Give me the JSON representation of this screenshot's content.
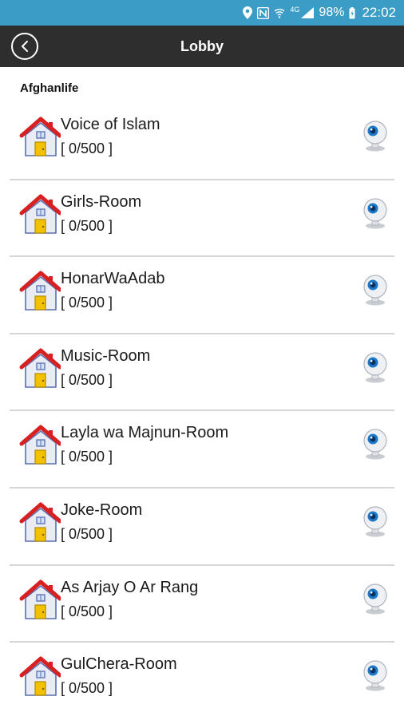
{
  "status_bar": {
    "network_label": "4G",
    "battery": "98%",
    "time": "22:02"
  },
  "app_bar": {
    "title": "Lobby",
    "back_icon": "back-arrow-circle-icon"
  },
  "section": {
    "title": "Afghanlife"
  },
  "rooms": [
    {
      "name": "Voice of Islam",
      "count": "[ 0/500 ]"
    },
    {
      "name": "Girls-Room",
      "count": "[ 0/500 ]"
    },
    {
      "name": "HonarWaAdab",
      "count": "[ 0/500 ]"
    },
    {
      "name": "Music-Room",
      "count": "[ 0/500 ]"
    },
    {
      "name": "Layla wa Majnun-Room",
      "count": "[ 0/500 ]"
    },
    {
      "name": "Joke-Room",
      "count": "[ 0/500 ]"
    },
    {
      "name": "As Arjay O Ar Rang",
      "count": "[ 0/500 ]"
    },
    {
      "name": "GulChera-Room",
      "count": "[ 0/500 ]"
    }
  ],
  "colors": {
    "status_bar": "#3b9dc5",
    "app_bar": "#2e2e2e",
    "house_roof": "#d82020",
    "house_door": "#f2c200",
    "divider": "#d6d6d6"
  }
}
